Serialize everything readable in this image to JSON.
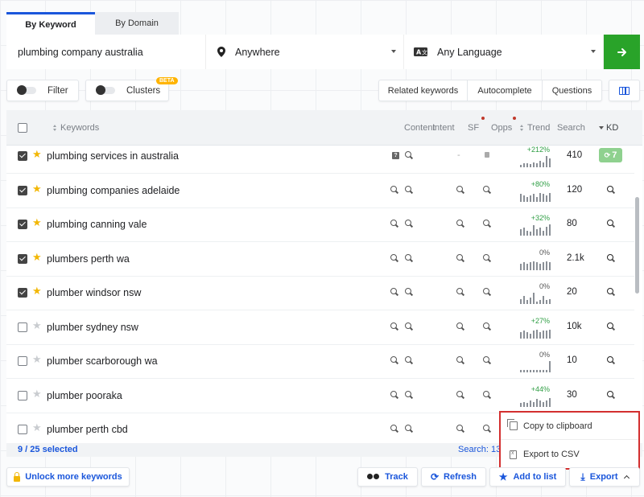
{
  "tabs": [
    {
      "label": "By Keyword",
      "active": true
    },
    {
      "label": "By Domain",
      "active": false
    }
  ],
  "search": {
    "keyword_value": "plumbing company australia",
    "location_label": "Anywhere",
    "language_label": "Any Language",
    "go_icon": "arrow-right-icon"
  },
  "filters": {
    "filter_label": "Filter",
    "clusters_label": "Clusters",
    "beta_label": "BETA",
    "related_label": "Related keywords",
    "autocomplete_label": "Autocomplete",
    "questions_label": "Questions"
  },
  "table": {
    "headers": {
      "keywords": "Keywords",
      "content": "Content",
      "intent": "Intent",
      "sf": "SF",
      "opps": "Opps",
      "trend": "Trend",
      "search": "Search",
      "kd": "KD"
    },
    "rows": [
      {
        "keyword": "plumbing services in australia",
        "checked": true,
        "starred": true,
        "trend_pct": "+212%",
        "volume": "410",
        "kd": "7",
        "bars": [
          0.2,
          0.3,
          0.3,
          0.25,
          0.35,
          0.3,
          0.5,
          0.4,
          0.9,
          0.7
        ]
      },
      {
        "keyword": "plumbing companies adelaide",
        "checked": true,
        "starred": true,
        "trend_pct": "+80%",
        "volume": "120",
        "kd": "",
        "bars": [
          0.6,
          0.5,
          0.4,
          0.5,
          0.6,
          0.4,
          0.7,
          0.6,
          0.5,
          0.7
        ]
      },
      {
        "keyword": "plumbing canning vale",
        "checked": true,
        "starred": true,
        "trend_pct": "+32%",
        "volume": "80",
        "kd": "",
        "bars": [
          0.5,
          0.6,
          0.4,
          0.3,
          0.8,
          0.5,
          0.6,
          0.4,
          0.7,
          0.9
        ]
      },
      {
        "keyword": "plumbers perth wa",
        "checked": true,
        "starred": true,
        "trend_pct": "0%",
        "volume": "2.1k",
        "kd": "",
        "bars": [
          0.5,
          0.6,
          0.5,
          0.6,
          0.7,
          0.6,
          0.5,
          0.6,
          0.7,
          0.6
        ]
      },
      {
        "keyword": "plumber windsor nsw",
        "checked": true,
        "starred": true,
        "trend_pct": "0%",
        "volume": "20",
        "kd": "",
        "bars": [
          0.4,
          0.6,
          0.3,
          0.5,
          0.9,
          0.2,
          0.3,
          0.6,
          0.3,
          0.4
        ]
      },
      {
        "keyword": "plumber sydney nsw",
        "checked": false,
        "starred": false,
        "trend_pct": "+27%",
        "volume": "10k",
        "kd": "",
        "bars": [
          0.5,
          0.6,
          0.5,
          0.4,
          0.6,
          0.7,
          0.5,
          0.6,
          0.6,
          0.7
        ]
      },
      {
        "keyword": "plumber scarborough wa",
        "checked": false,
        "starred": false,
        "trend_pct": "0%",
        "volume": "10",
        "kd": "",
        "bars": [
          0.2,
          0.2,
          0.2,
          0.2,
          0.2,
          0.2,
          0.2,
          0.2,
          0.2,
          0.9
        ]
      },
      {
        "keyword": "plumber pooraka",
        "checked": false,
        "starred": false,
        "trend_pct": "+44%",
        "volume": "30",
        "kd": "",
        "bars": [
          0.3,
          0.4,
          0.3,
          0.5,
          0.4,
          0.6,
          0.5,
          0.4,
          0.5,
          0.7
        ]
      },
      {
        "keyword": "plumber perth cbd",
        "checked": false,
        "starred": false,
        "trend_pct": "",
        "volume": "",
        "kd": "",
        "bars": []
      }
    ],
    "selected_label": "9 / 25 selected",
    "search_total": "Search: 13"
  },
  "export_menu": {
    "copy_label": "Copy to clipboard",
    "csv_label": "Export to CSV"
  },
  "bottom": {
    "unlock_label": "Unlock more keywords",
    "track_label": "Track",
    "refresh_label": "Refresh",
    "add_list_label": "Add to list",
    "export_label": "Export"
  },
  "colors": {
    "accent": "#1a56db",
    "go_button": "#29a329",
    "trend_positive": "#2f9e44",
    "kd_badge": "#8fd18f",
    "menu_highlight": "#d32f2f"
  }
}
